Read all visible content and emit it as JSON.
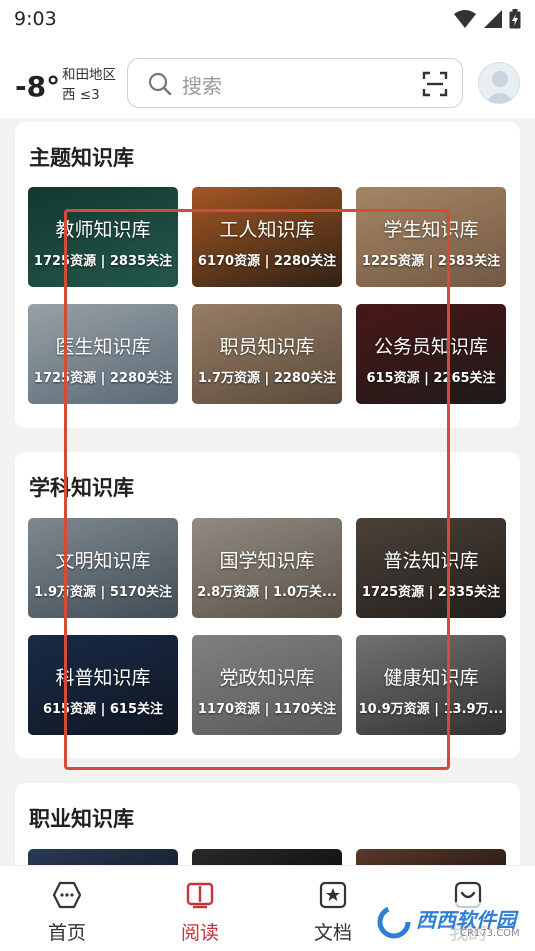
{
  "status_bar": {
    "time": "9:03"
  },
  "weather": {
    "temperature": "-8°",
    "region": "和田地区",
    "wind": "西 ≤3"
  },
  "search": {
    "placeholder": "搜索"
  },
  "sections": [
    {
      "title": "主题知识库",
      "items": [
        {
          "name": "教师知识库",
          "stats": "1725资源 | 2835关注",
          "colors": [
            "#17453c",
            "#2c6b5a"
          ]
        },
        {
          "name": "工人知识库",
          "stats": "6170资源 | 2280关注",
          "colors": [
            "#c66a2a",
            "#3b2a1c"
          ]
        },
        {
          "name": "学生知识库",
          "stats": "1225资源 | 2583关注",
          "colors": [
            "#c9a57d",
            "#8d6c52"
          ]
        },
        {
          "name": "医生知识库",
          "stats": "1725资源 | 2280关注",
          "colors": [
            "#b9c4cc",
            "#6f8290"
          ]
        },
        {
          "name": "职员知识库",
          "stats": "1.7万资源 | 2280关注",
          "colors": [
            "#b89a7c",
            "#6f5a48"
          ]
        },
        {
          "name": "公务员知识库",
          "stats": "615资源 | 2265关注",
          "colors": [
            "#5a1d1d",
            "#262020"
          ]
        }
      ]
    },
    {
      "title": "学科知识库",
      "items": [
        {
          "name": "文明知识库",
          "stats": "1.9万资源 | 5170关注",
          "colors": [
            "#9aa7b2",
            "#525e68"
          ]
        },
        {
          "name": "国学知识库",
          "stats": "2.8万资源 | 1.0万关...",
          "colors": [
            "#b3aa9e",
            "#6e6458"
          ]
        },
        {
          "name": "普法知识库",
          "stats": "1725资源 | 2835关注",
          "colors": [
            "#5d5045",
            "#2b2622"
          ]
        },
        {
          "name": "科普知识库",
          "stats": "615资源 | 615关注",
          "colors": [
            "#1f3558",
            "#151c2c"
          ]
        },
        {
          "name": "党政知识库",
          "stats": "1170资源 | 1170关注",
          "colors": [
            "#9d9d9d",
            "#6c6c6c"
          ]
        },
        {
          "name": "健康知识库",
          "stats": "10.9万资源 | 13.9万...",
          "colors": [
            "#8b8b8b",
            "#3c3c3c"
          ]
        }
      ]
    },
    {
      "title": "职业知识库",
      "items": [
        {
          "name": "",
          "stats": "",
          "colors": [
            "#2a3a56",
            "#16202e"
          ]
        },
        {
          "name": "",
          "stats": "",
          "colors": [
            "#2a2a2a",
            "#111111"
          ]
        },
        {
          "name": "",
          "stats": "",
          "colors": [
            "#5a3a2a",
            "#2a1a14"
          ]
        }
      ]
    }
  ],
  "bottom_nav": [
    {
      "label": "首页",
      "icon": "home-icon",
      "active": false
    },
    {
      "label": "阅读",
      "icon": "book-icon",
      "active": true
    },
    {
      "label": "文档",
      "icon": "document-star-icon",
      "active": false
    },
    {
      "label": "我的",
      "icon": "profile-icon",
      "active": false
    }
  ],
  "watermark": {
    "text": "西西软件园",
    "sub": "CR173.COM"
  },
  "colors": {
    "accent": "#c8323a",
    "highlight_box": "#d64a3a"
  }
}
